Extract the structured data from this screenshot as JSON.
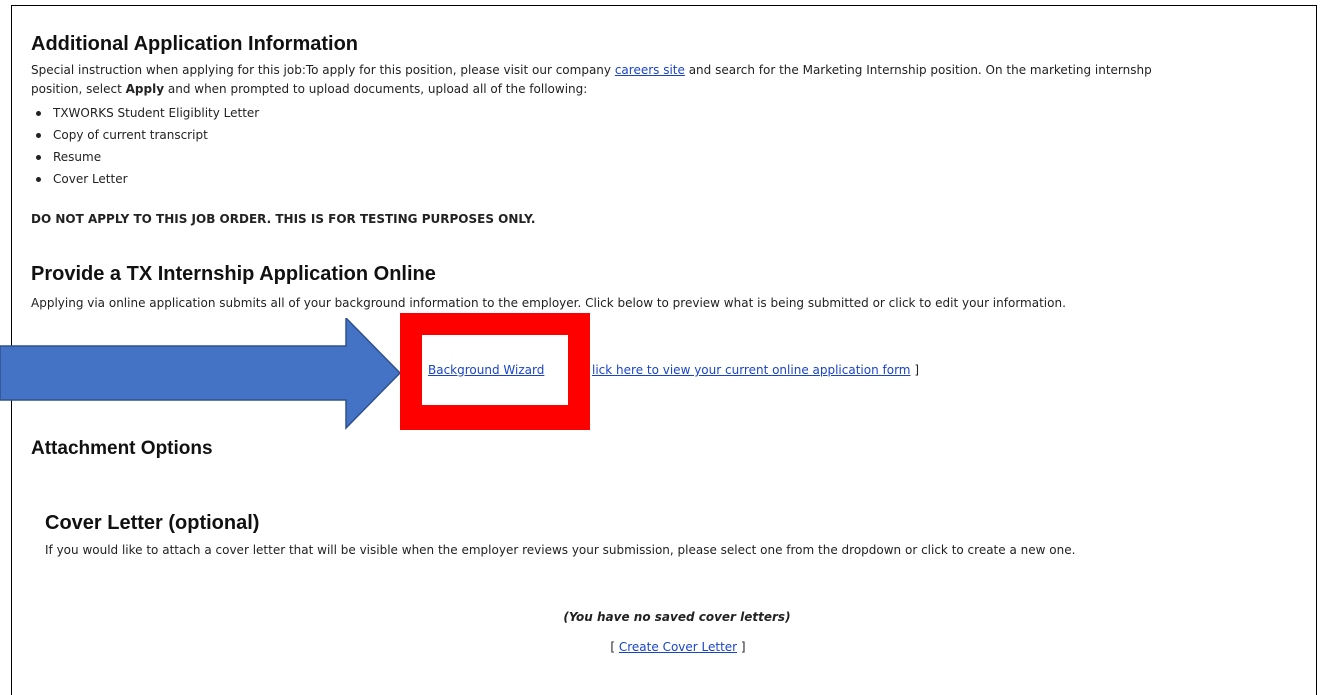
{
  "additional": {
    "heading": "Additional Application Information",
    "line1_pre": "Special instruction when applying for this job:To apply for this position, please visit our company ",
    "careers_link": "careers site",
    "line1_post": " and search for the Marketing Internship position.  On the marketing internshp",
    "line2_pre": "position, select ",
    "line2_bold": "Apply",
    "line2_post": " and when prompted to upload documents, upload all of the following:",
    "bullets": [
      "TXWORKS Student Eligiblity Letter",
      "Copy of current transcript",
      "Resume",
      "Cover Letter"
    ],
    "notice": "DO NOT APPLY TO THIS JOB ORDER.  THIS IS FOR TESTING PURPOSES ONLY."
  },
  "online_app": {
    "heading": "Provide a TX Internship Application Online",
    "description": "Applying via online application submits all of your background information to the employer. Click below to preview what is being submitted or click to edit your information.",
    "wizard_link": "Background Wizard",
    "view_link_visible": "lick here to view your current online application form",
    "bracket_close": " ]"
  },
  "attachments": {
    "heading": "Attachment Options"
  },
  "cover_letter": {
    "heading": "Cover Letter (optional)",
    "description": "If you would like to attach a cover letter that will be visible when the employer reviews your submission, please select one from the dropdown or click to create a new one.",
    "empty_message": "(You have no saved cover letters)",
    "bracket_open": "[ ",
    "create_link": "Create Cover Letter",
    "bracket_close": " ]"
  },
  "colors": {
    "link": "#1a44c8",
    "arrow_fill": "#4472c4",
    "arrow_stroke": "#2f528f",
    "highlight": "#ff0000"
  }
}
